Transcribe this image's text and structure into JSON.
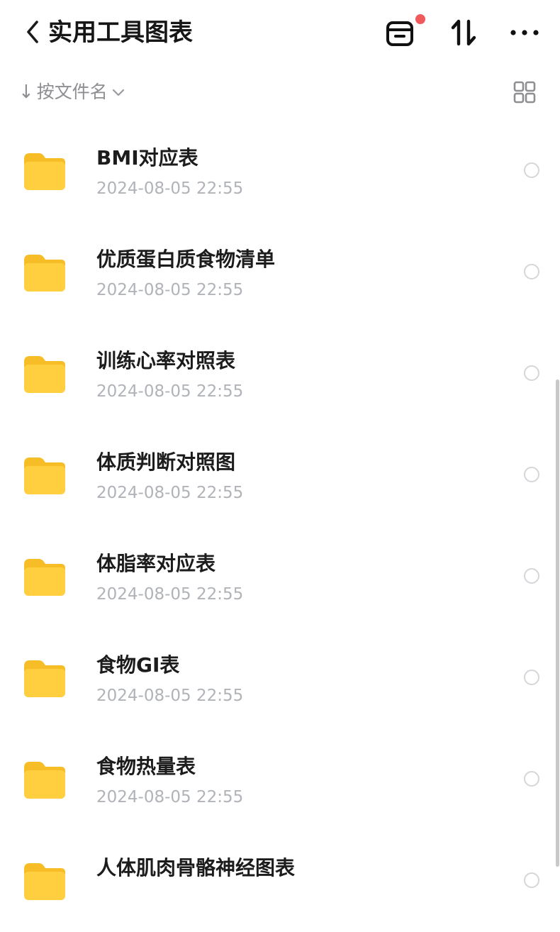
{
  "header": {
    "title": "实用工具图表",
    "back_icon": "chevron-left-icon",
    "actions": [
      {
        "name": "transfer-list-icon",
        "has_badge": true
      },
      {
        "name": "sort-swap-icon"
      },
      {
        "name": "more-icon"
      }
    ]
  },
  "sortbar": {
    "arrow": "↓",
    "label": "按文件名",
    "dropdown_icon": "chevron-down-icon",
    "view_toggle_icon": "grid-view-icon"
  },
  "files": [
    {
      "name": "BMI对应表",
      "date": "2024-08-05 22:55"
    },
    {
      "name": "优质蛋白质食物清单",
      "date": "2024-08-05 22:55"
    },
    {
      "name": "训练心率对照表",
      "date": "2024-08-05 22:55"
    },
    {
      "name": "体质判断对照图",
      "date": "2024-08-05 22:55"
    },
    {
      "name": "体脂率对应表",
      "date": "2024-08-05 22:55"
    },
    {
      "name": "食物GI表",
      "date": "2024-08-05 22:55"
    },
    {
      "name": "食物热量表",
      "date": "2024-08-05 22:55"
    },
    {
      "name": "人体肌肉骨骼神经图表",
      "date": ""
    }
  ],
  "colors": {
    "folder": "#ffcf40",
    "folder_tab": "#f7bd26",
    "badge": "#f05a5a",
    "muted_text": "#8e8e93",
    "date_text": "#b0b3b8"
  }
}
